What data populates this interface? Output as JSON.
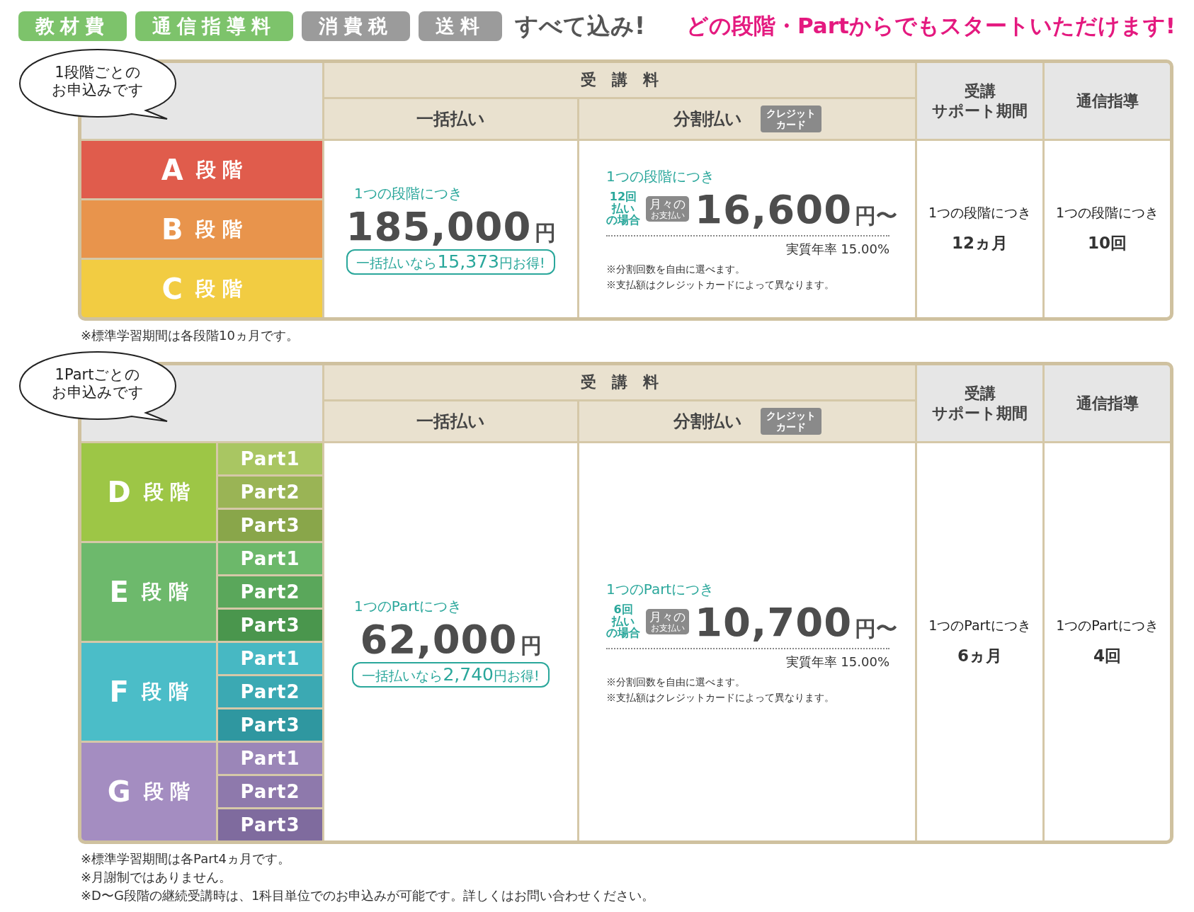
{
  "header_tags": [
    {
      "label": "教材費",
      "color": "#7dc36b"
    },
    {
      "label": "通信指導料",
      "color": "#7dc36b"
    },
    {
      "label": "消費税",
      "color": "#9b9b9b"
    },
    {
      "label": "送料",
      "color": "#9b9b9b"
    }
  ],
  "included_text": "すべて込み!",
  "slogan": "どの段階・Partからでもスタートいただけます!",
  "plans": [
    {
      "bubble": [
        "1段階ごとの",
        "お申込みです"
      ],
      "fee_header": "受　講　料",
      "lump_header": "一括払い",
      "installment_header": "分割払い",
      "card_badge": [
        "クレジット",
        "カード"
      ],
      "support_header": [
        "受講",
        "サポート期間"
      ],
      "guidance_header": "通信指導",
      "levels": [
        {
          "letter": "A",
          "label": "段 階",
          "color": "#e05c4c"
        },
        {
          "letter": "B",
          "label": "段 階",
          "color": "#e8944c"
        },
        {
          "letter": "C",
          "label": "段 階",
          "color": "#f2cc42"
        }
      ],
      "lump": {
        "unit": "1つの段階につき",
        "price": "185,000",
        "yen": "円",
        "savings_prefix": "一括払いなら",
        "savings_amount": "15,373",
        "savings_suffix": "円お得!"
      },
      "installment": {
        "unit": "1つの段階につき",
        "count": [
          "12回",
          "払い",
          "の場合"
        ],
        "monthly_badge_top": "月々の",
        "monthly_badge_bottom": "お支払い",
        "price": "16,600",
        "yen": "円〜",
        "apr": "実質年率 15.00%",
        "notes": [
          "※分割回数を自由に選べます。",
          "※支払額はクレジットカードによって異なります。"
        ]
      },
      "support": {
        "unit": "1つの段階につき",
        "value": "12ヵ月"
      },
      "guidance": {
        "unit": "1つの段階につき",
        "value": "10回"
      },
      "notes": [
        "※標準学習期間は各段階10ヵ月です。"
      ]
    },
    {
      "bubble": [
        "1Partごとの",
        "お申込みです"
      ],
      "fee_header": "受　講　料",
      "lump_header": "一括払い",
      "installment_header": "分割払い",
      "card_badge": [
        "クレジット",
        "カード"
      ],
      "support_header": [
        "受講",
        "サポート期間"
      ],
      "guidance_header": "通信指導",
      "levels": [
        {
          "letter": "D",
          "label": "段 階",
          "color": "#9dc646",
          "parts": [
            {
              "label": "Part1",
              "color": "#a9c662"
            },
            {
              "label": "Part2",
              "color": "#9ab455"
            },
            {
              "label": "Part3",
              "color": "#89a64a"
            }
          ]
        },
        {
          "letter": "E",
          "label": "段 階",
          "color": "#6db96c",
          "parts": [
            {
              "label": "Part1",
              "color": "#6cb86a"
            },
            {
              "label": "Part2",
              "color": "#5aa75b"
            },
            {
              "label": "Part3",
              "color": "#4a964d"
            }
          ]
        },
        {
          "letter": "F",
          "label": "段 階",
          "color": "#4bbdc8",
          "parts": [
            {
              "label": "Part1",
              "color": "#47b8c3"
            },
            {
              "label": "Part2",
              "color": "#3ba9b3"
            },
            {
              "label": "Part3",
              "color": "#2f97a0"
            }
          ]
        },
        {
          "letter": "G",
          "label": "段 階",
          "color": "#a48dc1",
          "parts": [
            {
              "label": "Part1",
              "color": "#9b86b8"
            },
            {
              "label": "Part2",
              "color": "#8e79ac"
            },
            {
              "label": "Part3",
              "color": "#7f6b9e"
            }
          ]
        }
      ],
      "lump": {
        "unit": "1つのPartにつき",
        "price": "62,000",
        "yen": "円",
        "savings_prefix": "一括払いなら",
        "savings_amount": "2,740",
        "savings_suffix": "円お得!"
      },
      "installment": {
        "unit": "1つのPartにつき",
        "count": [
          "6回",
          "払い",
          "の場合"
        ],
        "monthly_badge_top": "月々の",
        "monthly_badge_bottom": "お支払い",
        "price": "10,700",
        "yen": "円〜",
        "apr": "実質年率 15.00%",
        "notes": [
          "※分割回数を自由に選べます。",
          "※支払額はクレジットカードによって異なります。"
        ]
      },
      "support": {
        "unit": "1つのPartにつき",
        "value": "6ヵ月"
      },
      "guidance": {
        "unit": "1つのPartにつき",
        "value": "4回"
      },
      "notes": [
        "※標準学習期間は各Part4ヵ月です。",
        "※月謝制ではありません。",
        "※D〜G段階の継続受講時は、1科目単位でのお申込みが可能です。詳しくはお問い合わせください。"
      ]
    }
  ]
}
